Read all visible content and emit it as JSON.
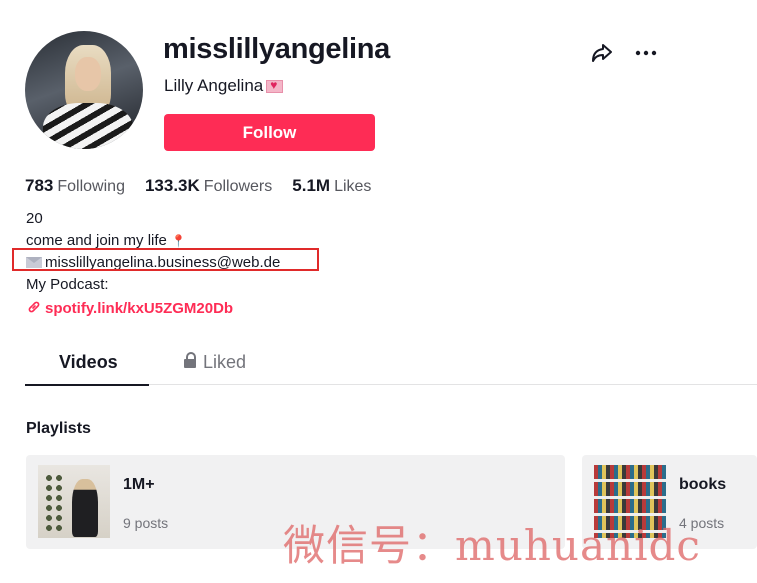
{
  "profile": {
    "username": "misslillyangelina",
    "nickname": "Lilly Angelina",
    "follow_label": "Follow"
  },
  "stats": {
    "following_count": "783",
    "following_label": "Following",
    "followers_count": "133.3K",
    "followers_label": "Followers",
    "likes_count": "5.1M",
    "likes_label": "Likes"
  },
  "bio": {
    "line1": "20",
    "line2": "come and join my life",
    "email": "misslillyangelina.business@web.de",
    "line4": "My Podcast:",
    "link": "spotify.link/kxU5ZGM20Db"
  },
  "tabs": {
    "videos": "Videos",
    "liked": "Liked"
  },
  "playlists": {
    "title": "Playlists",
    "items": [
      {
        "name": "1M+",
        "count": "9 posts"
      },
      {
        "name": "books",
        "count": "4 posts"
      }
    ]
  },
  "watermark": "微信号：muhuanidc",
  "colors": {
    "accent": "#fe2c55",
    "highlight_box": "#e02a2a"
  },
  "icons": {
    "share": "share-icon",
    "more": "more-icon",
    "link": "link-icon",
    "lock": "lock-icon",
    "mail": "mail-icon",
    "heart": "heart-icon",
    "pin": "pin-icon"
  }
}
